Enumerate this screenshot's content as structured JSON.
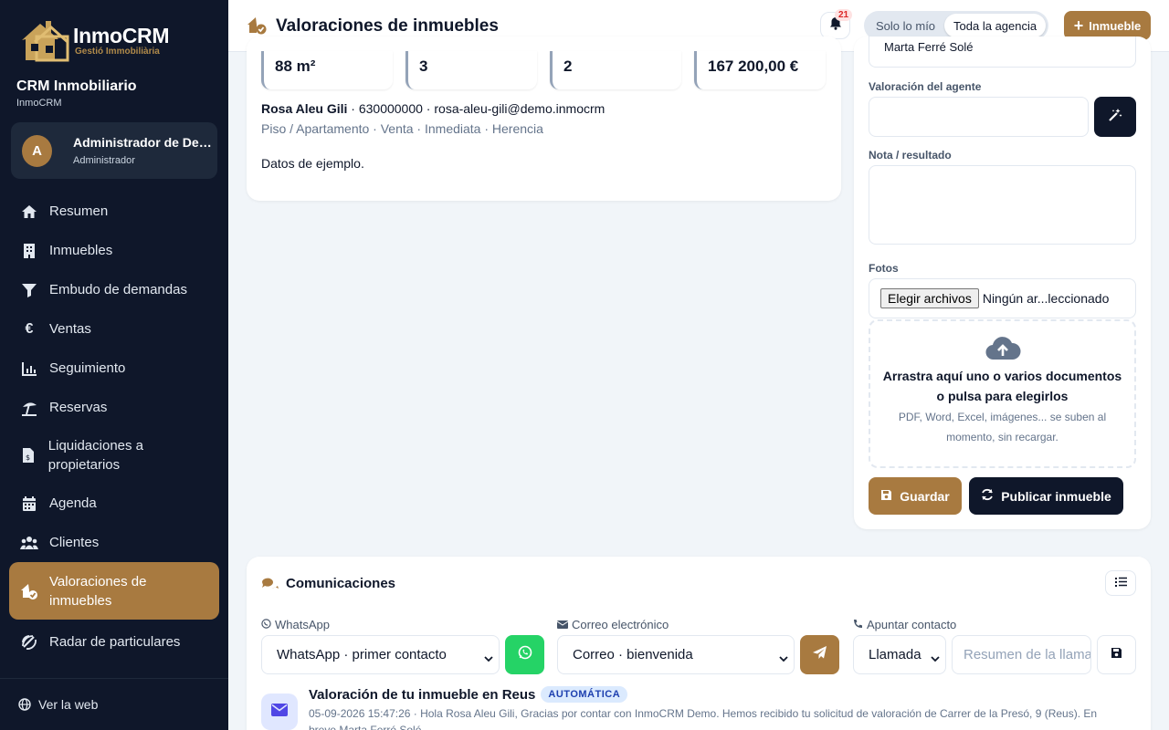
{
  "brand": {
    "name": "InmoCRM",
    "tagline": "Gestió Immobiliària",
    "crm_title": "CRM Inmobiliario",
    "crm_sub": "InmoCRM"
  },
  "user": {
    "initial": "A",
    "name": "Administrador de Demo",
    "role": "Administrador"
  },
  "nav": [
    {
      "label": "Resumen",
      "icon": "home-icon"
    },
    {
      "label": "Inmuebles",
      "icon": "building-icon"
    },
    {
      "label": "Embudo de demandas",
      "icon": "filter-icon"
    },
    {
      "label": "Ventas",
      "icon": "euro-icon"
    },
    {
      "label": "Seguimiento",
      "icon": "chart-icon"
    },
    {
      "label": "Reservas",
      "icon": "beach-umbrella-icon"
    },
    {
      "label": "Liquidaciones a propietarios",
      "icon": "invoice-icon"
    },
    {
      "label": "Agenda",
      "icon": "calendar-icon"
    },
    {
      "label": "Clientes",
      "icon": "users-icon"
    },
    {
      "label": "Valoraciones de inmuebles",
      "icon": "house-check-icon",
      "active": true
    },
    {
      "label": "Radar de particulares",
      "icon": "radar-icon"
    }
  ],
  "footer_link": "Ver la web",
  "header": {
    "title": "Valoraciones de inmuebles",
    "notifications": "21",
    "scope_mine": "Solo lo mío",
    "scope_all": "Toda la agencia",
    "new_label": "Inmueble"
  },
  "stats": [
    {
      "value": "88 m²"
    },
    {
      "value": "3"
    },
    {
      "value": "2"
    },
    {
      "value": "167 200,00 €"
    }
  ],
  "contact": {
    "name": "Rosa Aleu Gili",
    "phone": "630000000",
    "email": "rosa-aleu-gili@demo.inmocrm"
  },
  "meta": "Piso / Apartamento · Venta · Inmediata · Herencia",
  "note": "Datos de ejemplo.",
  "form": {
    "prev_value": "Marta Ferré Solé",
    "agent_label": "Valoración del agente",
    "agent_value": "",
    "note_label": "Nota / resultado",
    "photos_label": "Fotos",
    "file_button": "Elegir archivos",
    "file_status": "Ningún ar...leccionado",
    "drop_title": "Arrastra aquí uno o varios documentos o pulsa para elegirlos",
    "drop_sub": "PDF, Word, Excel, imágenes... se suben al momento, sin recargar.",
    "save": "Guardar",
    "publish": "Publicar inmueble"
  },
  "comm": {
    "title": "Comunicaciones",
    "whatsapp_label": "WhatsApp",
    "whatsapp_value": "WhatsApp · primer contacto",
    "email_label": "Correo electrónico",
    "email_value": "Correo · bienvenida",
    "contact_label": "Apuntar contacto",
    "contact_type": "Llamada",
    "contact_placeholder": "Resumen de la llamada",
    "message": {
      "title": "Valoración de tu inmueble en Reus",
      "badge": "AUTOMÁTICA",
      "body": "05-09-2026 15:47:26 · Hola Rosa Aleu Gili, Gracias por contar con InmoCRM Demo. Hemos recibido tu solicitud de valoración de Carrer de la Presó, 9 (Reus). En breve Marta Ferré Solé"
    }
  },
  "colors": {
    "accent": "#a87a40",
    "sidebar": "#0f172a",
    "whatsapp": "#25d366"
  }
}
